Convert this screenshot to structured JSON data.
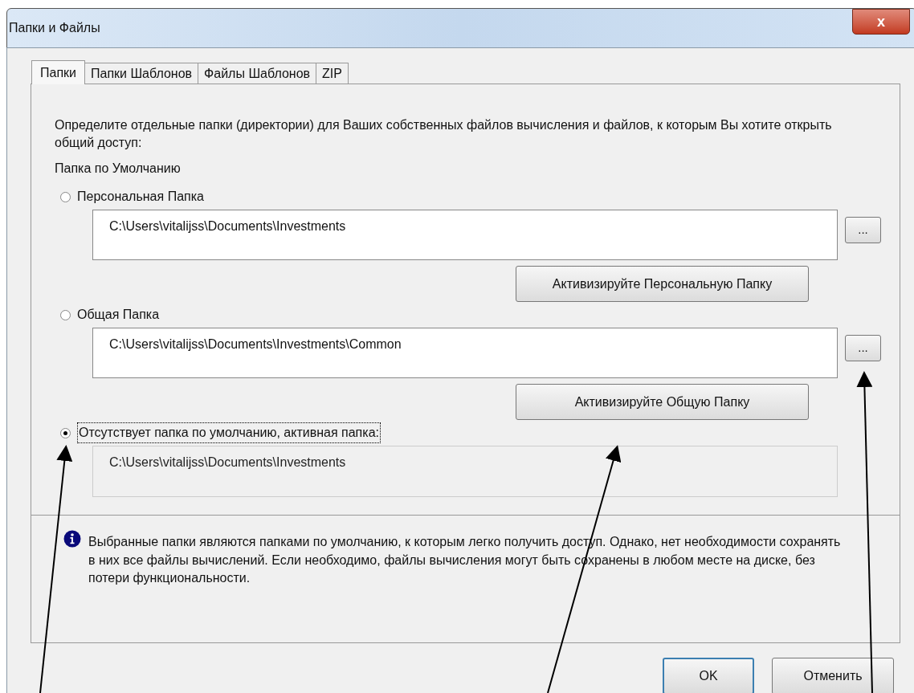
{
  "window": {
    "title": "Папки и Файлы",
    "close": "x"
  },
  "tabs": [
    {
      "label": "Папки",
      "selected": true
    },
    {
      "label": "Папки Шаблонов",
      "selected": false
    },
    {
      "label": "Файлы Шаблонов",
      "selected": false
    },
    {
      "label": "ZIP",
      "selected": false
    }
  ],
  "description": "Определите отдельные папки (директории) для Ваших собственных файлов вычисления и файлов, к которым Вы хотите открыть общий доступ:",
  "default_folder_label": "Папка по Умолчанию",
  "options": [
    {
      "label": "Персональная Папка",
      "selected": false,
      "path": "C:\\Users\\vitalijss\\Documents\\Investments",
      "disabled": false,
      "browse_button": "...",
      "activate_button": "Активизируйте Персональную Папку"
    },
    {
      "label": "Общая Папка",
      "selected": false,
      "path": "C:\\Users\\vitalijss\\Documents\\Investments\\Common",
      "disabled": false,
      "browse_button": "...",
      "activate_button": "Активизируйте Общую Папку"
    },
    {
      "label": "Отсутствует папка по умолчанию, активная папка:",
      "selected": true,
      "path": "C:\\Users\\vitalijss\\Documents\\Investments",
      "disabled": true
    }
  ],
  "info": "Выбранные папки являются папками по умолчанию, к которым легко получить доступ. Однако, нет необходимости сохранять в них все файлы вычислений. Если необходимо, файлы вычисления могут быть сохранены в любом месте на диске, без потери функциональности.",
  "buttons": [
    {
      "label": "OK"
    },
    {
      "label": "Отменить"
    }
  ]
}
